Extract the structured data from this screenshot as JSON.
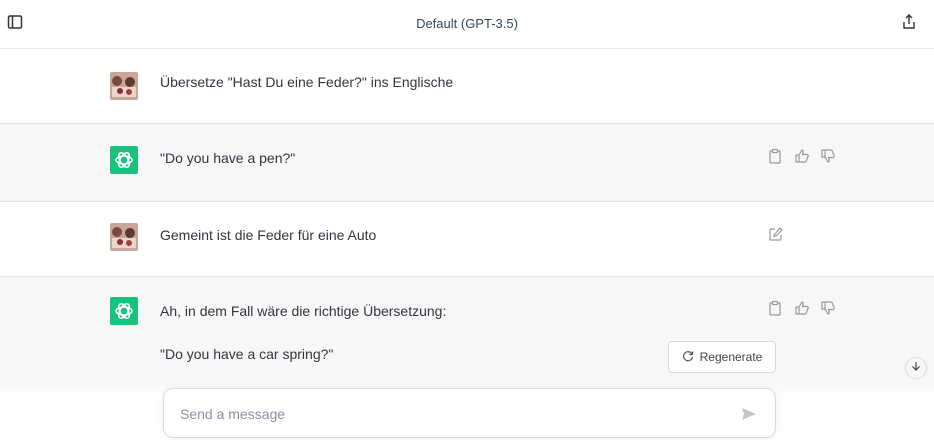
{
  "header": {
    "title": "Default (GPT-3.5)"
  },
  "conversation": [
    {
      "role": "user",
      "text": "Übersetze \"Hast Du eine Feder?\" ins Englische"
    },
    {
      "role": "assistant",
      "text": "\"Do you have a pen?\""
    },
    {
      "role": "user",
      "text": "Gemeint ist die Feder für eine Auto"
    },
    {
      "role": "assistant",
      "lines": [
        "Ah, in dem Fall wäre die richtige Übersetzung:",
        "\"Do you have a car spring?\""
      ]
    }
  ],
  "regenerate": {
    "label": "Regenerate"
  },
  "composer": {
    "placeholder": "Send a message",
    "value": ""
  },
  "colors": {
    "assistant_avatar": "#19c37d",
    "assistant_bg": "#f7f7f8",
    "user_bg": "#ffffff"
  },
  "icons": {
    "sidebar_toggle": "sidebar-toggle-icon",
    "share": "share-icon",
    "copy": "clipboard-icon",
    "like": "thumbs-up-icon",
    "dislike": "thumbs-down-icon",
    "edit": "edit-icon",
    "regenerate": "refresh-icon",
    "scroll": "arrow-down-icon",
    "send": "send-icon"
  }
}
